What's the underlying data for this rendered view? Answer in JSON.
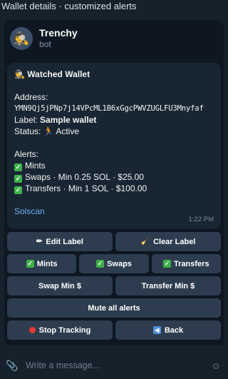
{
  "window": {
    "title": "Wallet details · customized alerts"
  },
  "chat": {
    "name": "Trenchy",
    "subtitle": "bot",
    "avatar_icon": "detective-emoji"
  },
  "message": {
    "header_icon": "detective-emoji",
    "title": "Watched Wallet",
    "address_label": "Address:",
    "address": "YMN9Qj5jPNp7j14VPcML1B6xGgcPWVZUGLFU3Mnyfaf",
    "label_prefix": "Label: ",
    "label_value": "Sample wallet",
    "status_prefix": "Status: ",
    "status_icon": "running-emoji",
    "status_value": "Active",
    "alerts_heading": "Alerts:",
    "alerts": [
      "Mints",
      "Swaps · Min 0.25 SOL · $25.00",
      "Transfers · Min 1 SOL · $100.00"
    ],
    "link": "Solscan",
    "time": "1:22 PM"
  },
  "keyboard": {
    "edit_label": "Edit Label",
    "clear_label": "Clear Label",
    "mints": "Mints",
    "swaps": "Swaps",
    "transfers": "Transfers",
    "swap_min": "Swap Min $",
    "transfer_min": "Transfer Min $",
    "mute_all": "Mute all alerts",
    "stop_tracking": "Stop Tracking",
    "back": "Back"
  },
  "composer": {
    "placeholder": "Write a message..."
  },
  "colors": {
    "background": "#0e1621",
    "bubble": "#182533",
    "button": "#2d3d4f",
    "link": "#6ab2f2",
    "check": "#3fb14a"
  }
}
